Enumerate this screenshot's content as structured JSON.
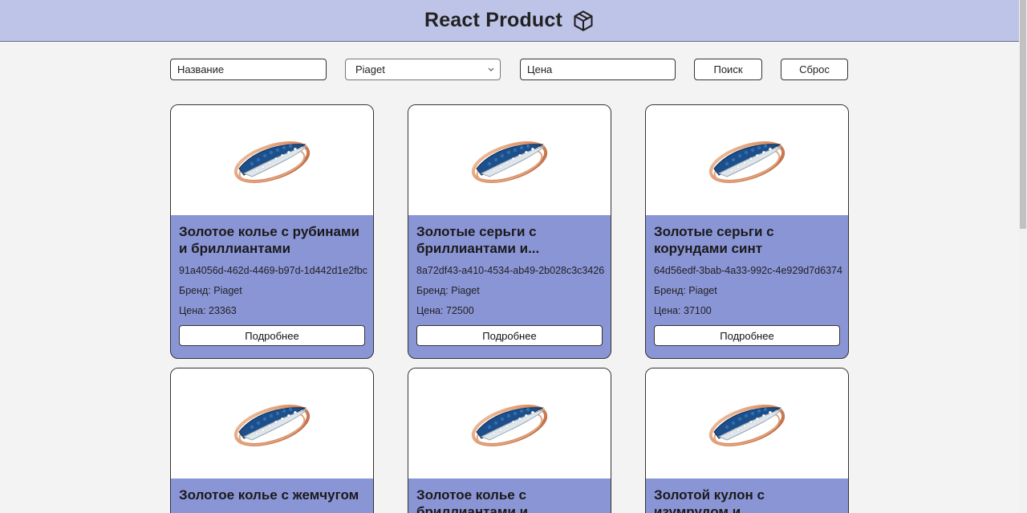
{
  "header": {
    "title": "React Product",
    "icon": "box-icon"
  },
  "filters": {
    "name_placeholder": "Название",
    "brand_selected": "Piaget",
    "price_placeholder": "Цена",
    "search_label": "Поиск",
    "reset_label": "Сброс"
  },
  "products": [
    {
      "title": "Золотое колье с рубинами и бриллиантами",
      "id": "91a4056d-462d-4469-b97d-1d442d1e2fbc",
      "brand": "Бренд: Piaget",
      "price": "Цена: 23363",
      "button": "Подробнее"
    },
    {
      "title": "Золотые серьги с бриллиантами и...",
      "id": "8a72df43-a410-4534-ab49-2b028c3c3426",
      "brand": "Бренд: Piaget",
      "price": "Цена: 72500",
      "button": "Подробнее"
    },
    {
      "title": "Золотые серьги с корундами синт",
      "id": "64d56edf-3bab-4a33-992c-4e929d7d6374",
      "brand": "Бренд: Piaget",
      "price": "Цена: 37100",
      "button": "Подробнее"
    },
    {
      "title": "Золотое колье с жемчугом",
      "id": "",
      "brand": "",
      "price": "",
      "button": ""
    },
    {
      "title": "Золотое колье с бриллиантами и",
      "id": "",
      "brand": "",
      "price": "",
      "button": ""
    },
    {
      "title": "Золотой кулон с изумрудом и бриллиантами",
      "id": "",
      "brand": "",
      "price": "",
      "button": ""
    }
  ]
}
